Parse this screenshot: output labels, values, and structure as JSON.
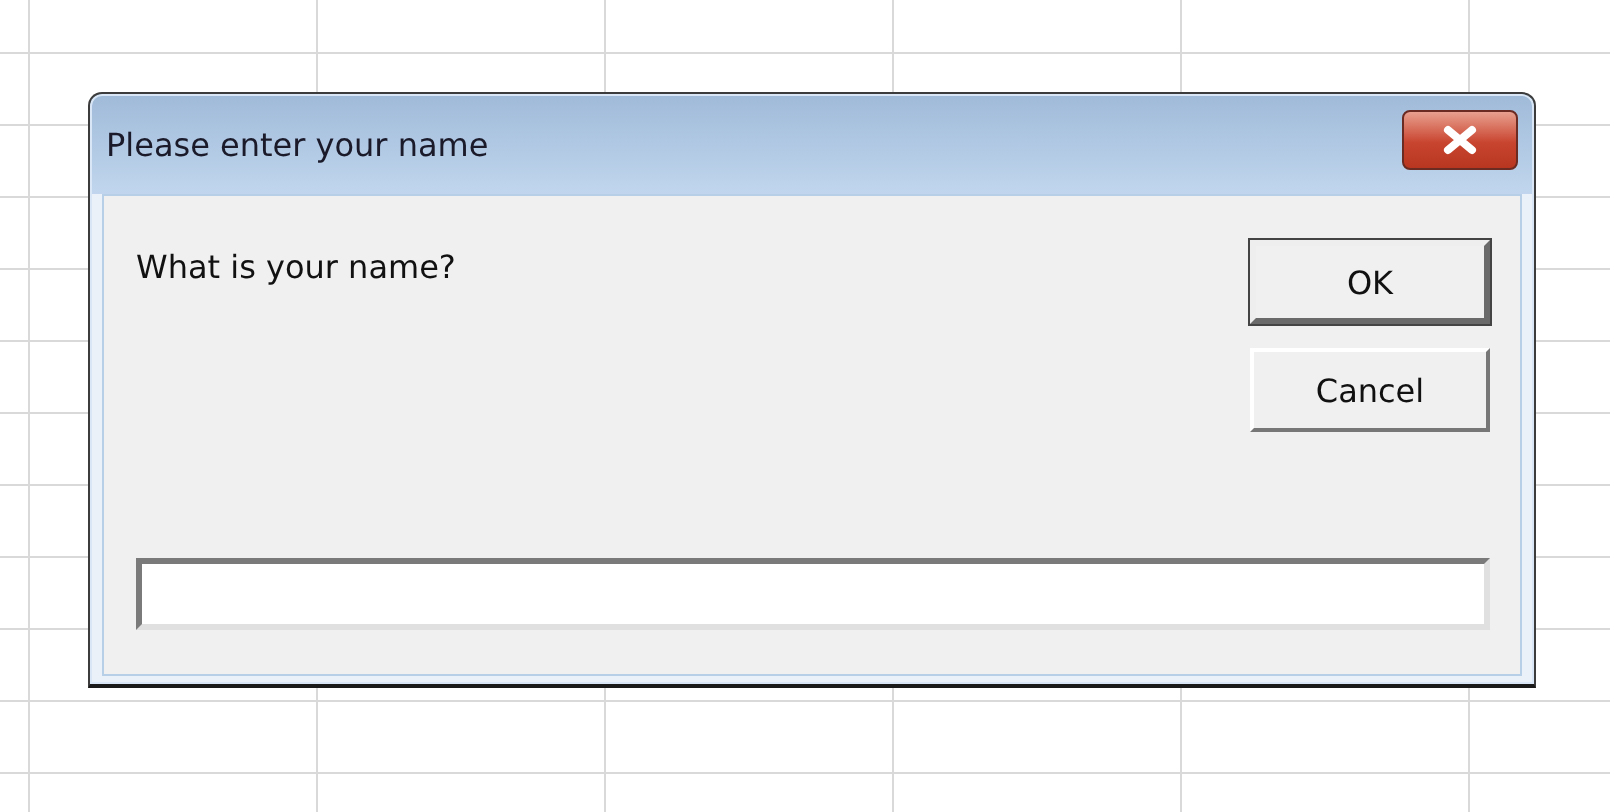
{
  "window": {
    "title": "Please enter your name"
  },
  "prompt": "What is your name?",
  "buttons": [
    {
      "label": "OK",
      "default": true
    },
    {
      "label": "Cancel",
      "default": false
    }
  ]
}
